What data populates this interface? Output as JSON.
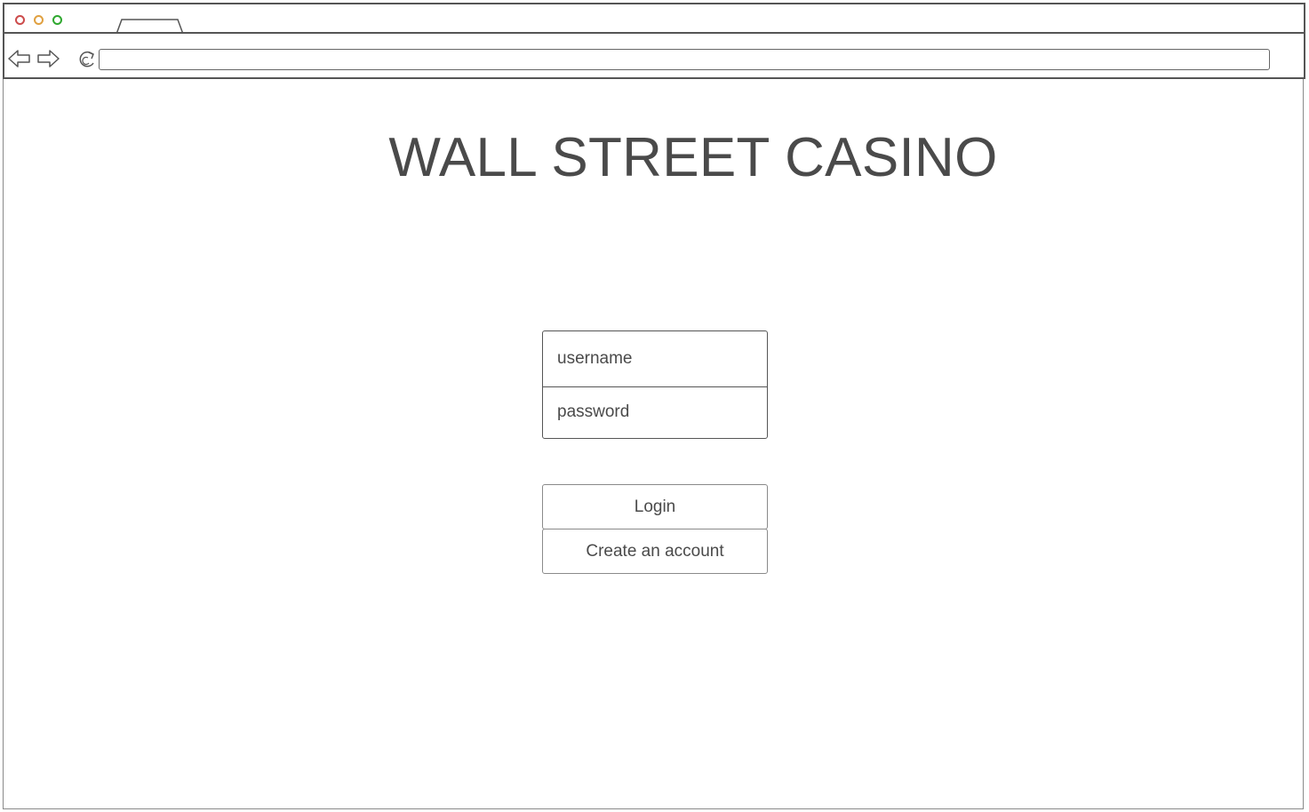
{
  "browser": {
    "window_controls": [
      {
        "name": "close",
        "color": "#cc4b4b"
      },
      {
        "name": "minimize",
        "color": "#e0a040"
      },
      {
        "name": "maximize",
        "color": "#2fa82f"
      }
    ],
    "address_bar": {
      "value": ""
    },
    "icons": {
      "back": "arrow-left-icon",
      "forward": "arrow-right-icon",
      "reload": "reload-icon"
    }
  },
  "page": {
    "title": "WALL STREET CASINO"
  },
  "login": {
    "username_placeholder": "username",
    "password_placeholder": "password",
    "login_label": "Login",
    "create_account_label": "Create an account"
  }
}
